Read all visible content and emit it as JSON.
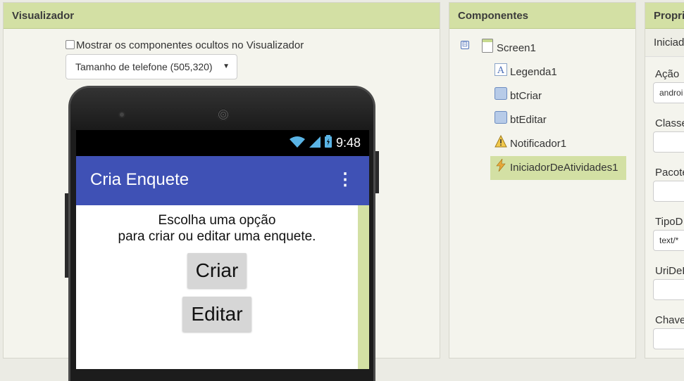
{
  "viewer": {
    "title": "Visualizador",
    "show_hidden_label": "Mostrar os componentes ocultos no Visualizador",
    "size_select_value": "Tamanho de telefone (505,320)"
  },
  "phone": {
    "time": "9:48",
    "app_title": "Cria Enquete",
    "menu_glyph": "⋮",
    "label_line1": "Escolha uma opção",
    "label_line2": "para criar ou editar uma enquete.",
    "button_create": "Criar",
    "button_edit": "Editar",
    "appbar_color": "#3f51b5"
  },
  "components": {
    "title": "Componentes",
    "collapse_glyph": "⊟",
    "root": "Screen1",
    "children": [
      {
        "name": "Legenda1",
        "icon": "label-icon"
      },
      {
        "name": "btCriar",
        "icon": "button-icon"
      },
      {
        "name": "btEditar",
        "icon": "button-icon"
      },
      {
        "name": "Notificador1",
        "icon": "warning-icon"
      },
      {
        "name": "IniciadorDeAtividades1",
        "icon": "lightning-icon",
        "selected": true
      }
    ],
    "selected_color": "#d3e0a4"
  },
  "properties": {
    "title": "Propri",
    "subheader": "Iniciad",
    "fields": [
      {
        "label": "Ação",
        "value": "androi"
      },
      {
        "label": "Classe",
        "value": ""
      },
      {
        "label": "Pacote",
        "value": ""
      },
      {
        "label": "TipoD",
        "value": "text/*"
      },
      {
        "label": "UriDeD",
        "value": ""
      },
      {
        "label": "Chave",
        "value": ""
      }
    ]
  }
}
